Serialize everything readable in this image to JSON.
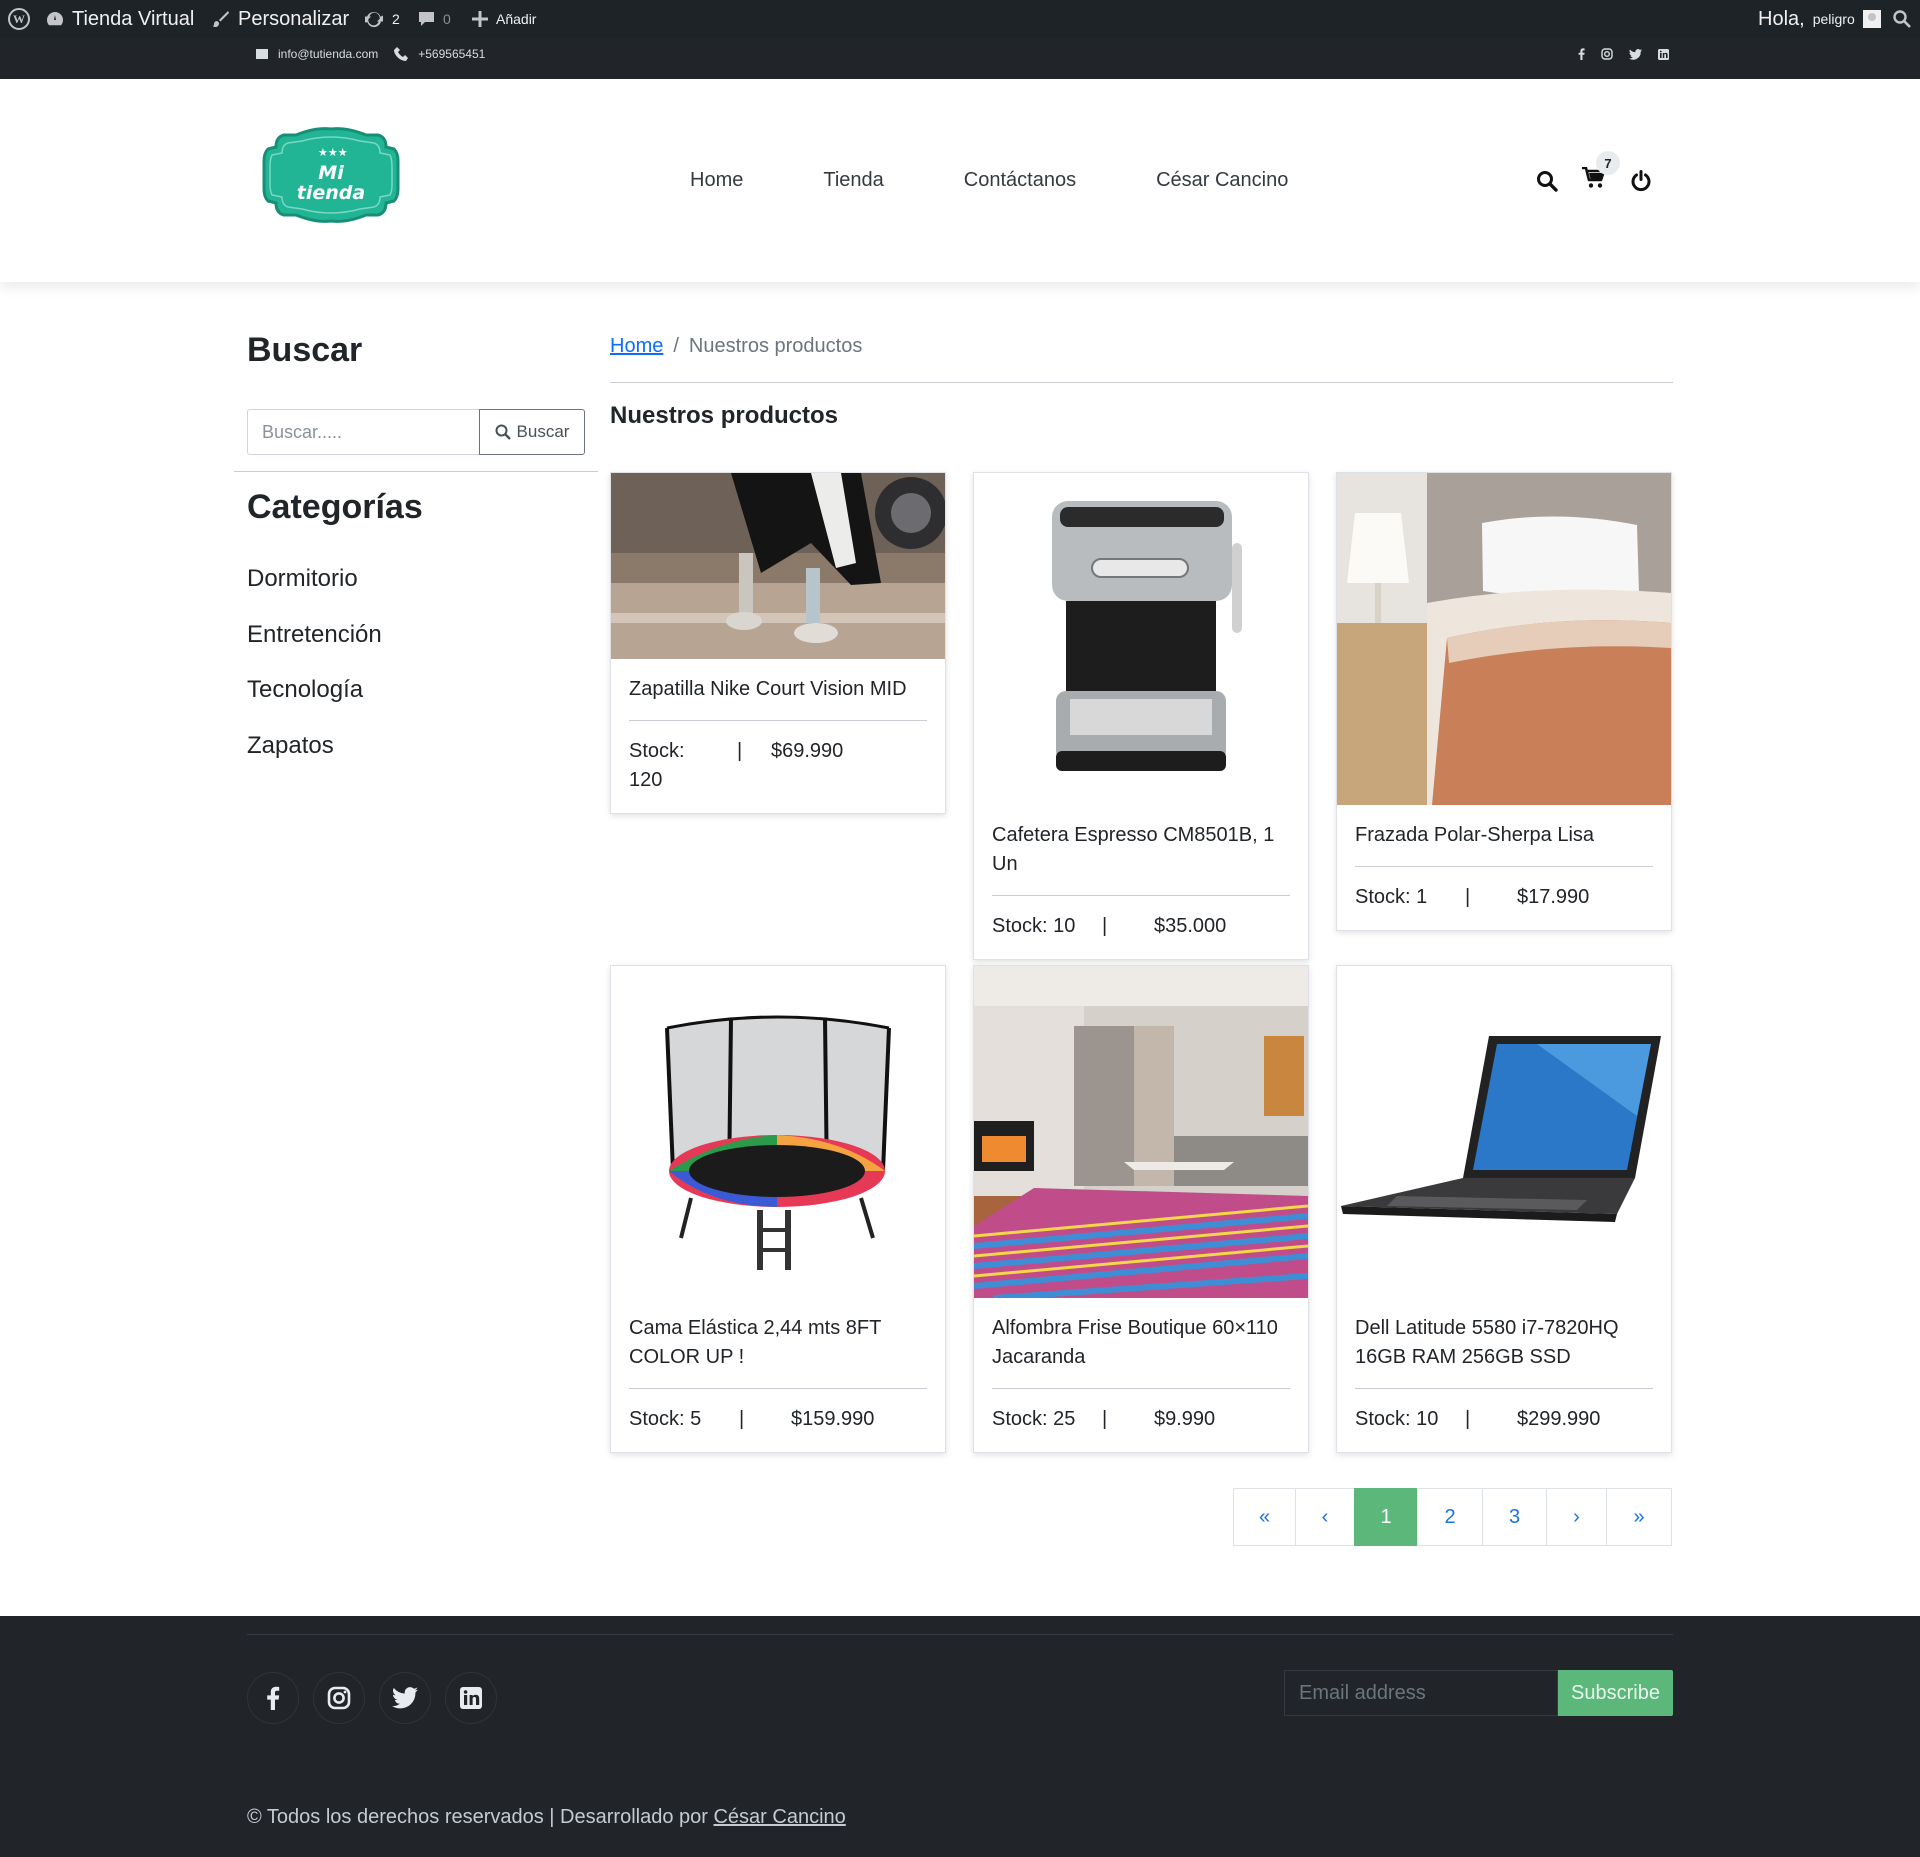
{
  "admin_bar": {
    "site_name": "Tienda Virtual",
    "customize_label": "Personalizar",
    "updates_count": "2",
    "comments_count": "0",
    "new_label": "Añadir",
    "greeting": "Hola,",
    "username": "peligro"
  },
  "top_bar": {
    "email": "info@tutienda.com",
    "phone": "+569565451"
  },
  "header": {
    "logo_line1": "Mi",
    "logo_line2": "tienda",
    "nav": [
      "Home",
      "Tienda",
      "Contáctanos",
      "César Cancino"
    ],
    "cart_count": "7"
  },
  "sidebar": {
    "search_title": "Buscar",
    "search_placeholder": "Buscar.....",
    "search_button": "Buscar",
    "categories_title": "Categorías",
    "categories": [
      "Dormitorio",
      "Entretención",
      "Tecnología",
      "Zapatos"
    ]
  },
  "main": {
    "breadcrumb_home": "Home",
    "breadcrumb_sep": "/",
    "breadcrumb_current": "Nuestros productos",
    "title": "Nuestros productos",
    "products": [
      {
        "name": "Zapatilla Nike Court Vision MID",
        "stock": "Stock: 120",
        "sep": "|",
        "price": "$69.990"
      },
      {
        "name": "Cafetera Espresso CM8501B, 1 Un",
        "stock": "Stock: 10",
        "sep": "|",
        "price": "$35.000"
      },
      {
        "name": "Frazada Polar-Sherpa Lisa",
        "stock": "Stock: 1",
        "sep": "|",
        "price": "$17.990"
      },
      {
        "name": "Cama Elástica 2,44 mts 8FT COLOR UP !",
        "stock": "Stock: 5",
        "sep": "|",
        "price": "$159.990"
      },
      {
        "name": "Alfombra Frise Boutique 60×110 Jacaranda",
        "stock": "Stock: 25",
        "sep": "|",
        "price": "$9.990"
      },
      {
        "name": "Dell Latitude 5580 i7-7820HQ 16GB RAM 256GB SSD",
        "stock": "Stock: 10",
        "sep": "|",
        "price": "$299.990"
      }
    ],
    "pagination": [
      "«",
      "‹",
      "1",
      "2",
      "3",
      "›",
      "»"
    ],
    "current_page": "1"
  },
  "footer": {
    "email_placeholder": "Email address",
    "subscribe_label": "Subscribe",
    "copyright_text": "© Todos los derechos reservados | Desarrollado por",
    "author_link": "César Cancino"
  },
  "colors": {
    "admin_bar_bg": "#1d2327",
    "top_bar_bg": "#212529",
    "accent_green": "#5cb87a",
    "logo_teal": "#21b596",
    "link_blue": "#0d6efd"
  }
}
